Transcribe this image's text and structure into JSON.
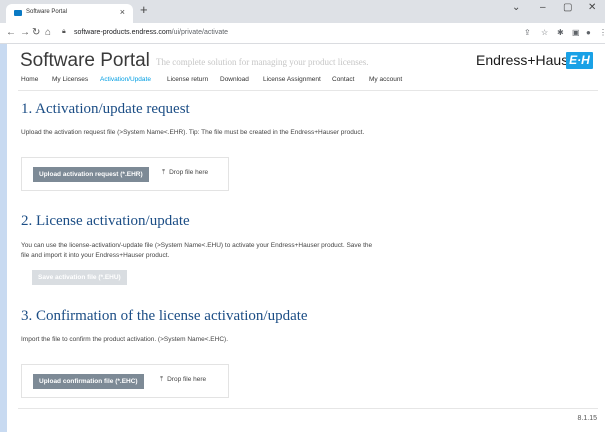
{
  "browser": {
    "tab_title": "Software Portal",
    "tab_close": "×",
    "new_tab": "+",
    "url_host": "software-products.endress.com",
    "url_path": "/ui/private/activate",
    "win_min": "–",
    "win_restore": "▢",
    "win_close": "✕",
    "win_chevron": "⌄"
  },
  "header": {
    "brand": "Software Portal",
    "tagline": "The complete solution for managing your product licenses.",
    "company": "Endress+Hauser",
    "logo_text": "E+H"
  },
  "menu": {
    "items": [
      "Home",
      "My Licenses",
      "Activation/Update",
      "License return",
      "Download",
      "License Assignment",
      "Contact",
      "My account"
    ],
    "active_index": 2
  },
  "sections": {
    "s1": {
      "title": "1. Activation/update request",
      "text": "Upload the activation request file (>System Name<.EHR). Tip: The file must be created in the Endress+Hauser product.",
      "button": "Upload activation request (*.EHR)",
      "drop": "Drop file here"
    },
    "s2": {
      "title": "2. License activation/update",
      "text": "You can use the license-activation/-update file (>System Name<.EHU) to activate your Endress+Hauser product. Save the file and import it into your Endress+Hauser product.",
      "button": "Save activation file (*.EHU)"
    },
    "s3": {
      "title": "3. Confirmation of the license activation/update",
      "text": "Import the file to confirm the product activation. (>System Name<.EHC).",
      "button": "Upload confirmation file (*.EHC)",
      "drop": "Drop file here"
    }
  },
  "footer": {
    "version": "8.1.15"
  },
  "colors": {
    "accent": "#009ee3",
    "heading": "#1b4d85",
    "button": "#7d8a96",
    "logo": "#19a1e6"
  }
}
